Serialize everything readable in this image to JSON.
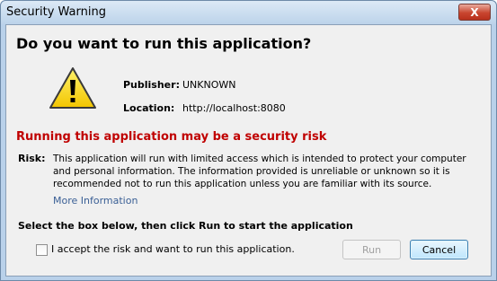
{
  "window": {
    "title": "Security Warning",
    "close_label": "X"
  },
  "dialog": {
    "heading": "Do you want to run this application?",
    "publisher_label": "Publisher:",
    "publisher_value": "UNKNOWN",
    "location_label": "Location:",
    "location_value": "http://localhost:8080",
    "risk_heading": "Running this application may be a security risk",
    "risk_label": "Risk:",
    "risk_text": "This application will run with limited access which is intended to protect your computer and personal information. The information provided is unreliable or unknown so it is recommended not to run this application unless you are familiar with its source.",
    "more_info": "More Information",
    "instruction": "Select the box below, then click Run to start the application",
    "checkbox_label": "I accept the risk and want to run this application.",
    "checkbox_checked": false
  },
  "buttons": {
    "run": "Run",
    "cancel": "Cancel",
    "run_enabled": false
  },
  "colors": {
    "risk_heading": "#c00000",
    "link": "#3a5f95",
    "warning_icon": "#f5d300"
  },
  "icons": {
    "warning": "warning-triangle-icon"
  }
}
